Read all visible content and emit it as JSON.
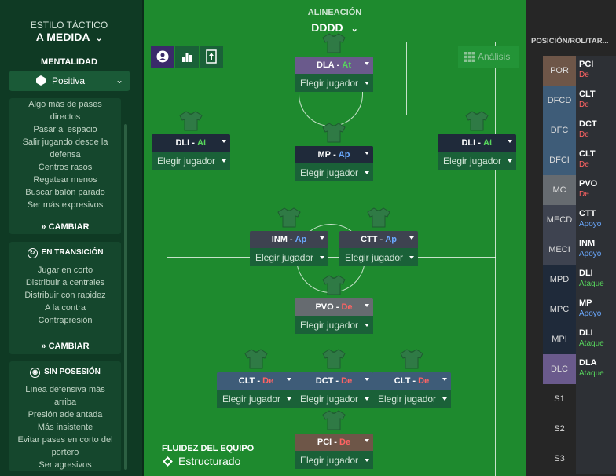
{
  "left_panel": {
    "style_label": "ESTILO TÁCTICO",
    "style_value": "A MEDIDA",
    "mentality_label": "MENTALIDAD",
    "mentality_value": "Positiva",
    "possession_instructions": [
      "Algo más de pases",
      "directos",
      "Pasar al espacio",
      "Salir jugando desde la",
      "defensa",
      "Centros rasos",
      "Regatear menos",
      "Buscar balón parado",
      "Ser más expresivos"
    ],
    "change_label": "CAMBIAR",
    "transition": {
      "title": "EN TRANSICIÓN",
      "items": [
        "Jugar en corto",
        "Distribuir a centrales",
        "Distribuir con rapidez",
        "A la contra",
        "Contrapresión"
      ],
      "change_label": "CAMBIAR"
    },
    "out_of_possession": {
      "title": "SIN POSESIÓN",
      "items": [
        "Línea defensiva más",
        "arriba",
        "Presión adelantada",
        "Más insistente",
        "Evitar pases en corto del",
        "portero",
        "Ser agresivos"
      ]
    }
  },
  "pitch": {
    "header_label": "ALINEACIÓN",
    "formation": "DDDD",
    "analysis_label": "Análisis",
    "fluidity_label": "FLUIDEZ DEL EQUIPO",
    "fluidity_value": "Estructurado",
    "pick_label": "Elegir jugador",
    "players": [
      {
        "role": "DLA",
        "duty": "At",
        "duty_class": "at",
        "color": "#6a5a8c"
      },
      {
        "role": "DLI",
        "duty": "At",
        "duty_class": "at",
        "color": "#1f2a3a"
      },
      {
        "role": "MP",
        "duty": "Ap",
        "duty_class": "ap",
        "color": "#1f2a3a"
      },
      {
        "role": "DLI",
        "duty": "At",
        "duty_class": "at",
        "color": "#1f2a3a"
      },
      {
        "role": "INM",
        "duty": "Ap",
        "duty_class": "ap",
        "color": "#3e4350"
      },
      {
        "role": "CTT",
        "duty": "Ap",
        "duty_class": "ap",
        "color": "#3e4350"
      },
      {
        "role": "PVO",
        "duty": "De",
        "duty_class": "de",
        "color": "#666b70"
      },
      {
        "role": "CLT",
        "duty": "De",
        "duty_class": "de",
        "color": "#3e5c78"
      },
      {
        "role": "DCT",
        "duty": "De",
        "duty_class": "de",
        "color": "#3e5c78"
      },
      {
        "role": "CLT",
        "duty": "De",
        "duty_class": "de",
        "color": "#3e5c78"
      },
      {
        "role": "PCI",
        "duty": "De",
        "duty_class": "de",
        "color": "#6e5648"
      }
    ]
  },
  "right_panel": {
    "header": "POSICIÓN/ROL/TAR...",
    "rows": [
      {
        "pos": "POR",
        "role": "PCI",
        "duty": "De",
        "duty_class": "de",
        "color": "#6e5648"
      },
      {
        "pos": "DFCD",
        "role": "CLT",
        "duty": "De",
        "duty_class": "de",
        "color": "#3e5c78"
      },
      {
        "pos": "DFC",
        "role": "DCT",
        "duty": "De",
        "duty_class": "de",
        "color": "#3e5c78"
      },
      {
        "pos": "DFCI",
        "role": "CLT",
        "duty": "De",
        "duty_class": "de",
        "color": "#3e5c78"
      },
      {
        "pos": "MC",
        "role": "PVO",
        "duty": "De",
        "duty_class": "de",
        "color": "#666b70"
      },
      {
        "pos": "MECD",
        "role": "CTT",
        "duty": "Apoyo",
        "duty_class": "ap",
        "color": "#3e4350"
      },
      {
        "pos": "MECI",
        "role": "INM",
        "duty": "Apoyo",
        "duty_class": "ap",
        "color": "#3e4350"
      },
      {
        "pos": "MPD",
        "role": "DLI",
        "duty": "Ataque",
        "duty_class": "at",
        "color": "#1f2a3a"
      },
      {
        "pos": "MPC",
        "role": "MP",
        "duty": "Apoyo",
        "duty_class": "ap",
        "color": "#1f2a3a"
      },
      {
        "pos": "MPI",
        "role": "DLI",
        "duty": "Ataque",
        "duty_class": "at",
        "color": "#1f2a3a"
      },
      {
        "pos": "DLC",
        "role": "DLA",
        "duty": "Ataque",
        "duty_class": "at",
        "color": "#6a5a8c"
      },
      {
        "pos": "S1",
        "role": "",
        "duty": "",
        "duty_class": "",
        "color": "#262626"
      },
      {
        "pos": "S2",
        "role": "",
        "duty": "",
        "duty_class": "",
        "color": "#262626"
      },
      {
        "pos": "S3",
        "role": "",
        "duty": "",
        "duty_class": "",
        "color": "#262626"
      }
    ]
  }
}
